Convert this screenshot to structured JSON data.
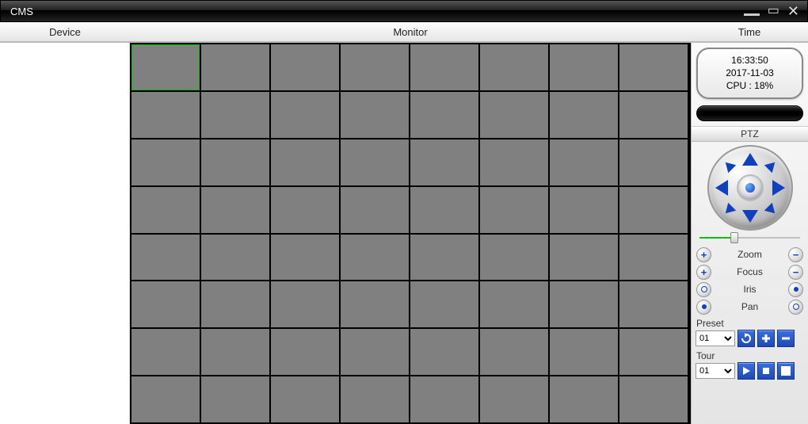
{
  "titlebar": {
    "title": "CMS"
  },
  "header": {
    "device": "Device",
    "monitor": "Monitor",
    "time": "Time"
  },
  "info": {
    "time": "16:33:50",
    "date": "2017-11-03",
    "cpu": "CPU : 18%"
  },
  "ptz": {
    "title": "PTZ",
    "controls": [
      {
        "label": "Zoom",
        "plus": "+",
        "minus": "−"
      },
      {
        "label": "Focus",
        "plus": "+",
        "minus": "−"
      },
      {
        "label": "Iris",
        "plus": "",
        "minus": ""
      },
      {
        "label": "Pan",
        "plus": "",
        "minus": ""
      }
    ],
    "preset_label": "Preset",
    "tour_label": "Tour",
    "preset_value": "01",
    "tour_value": "01"
  },
  "grid": {
    "cols": 8,
    "rows": 8,
    "selected": 0
  }
}
